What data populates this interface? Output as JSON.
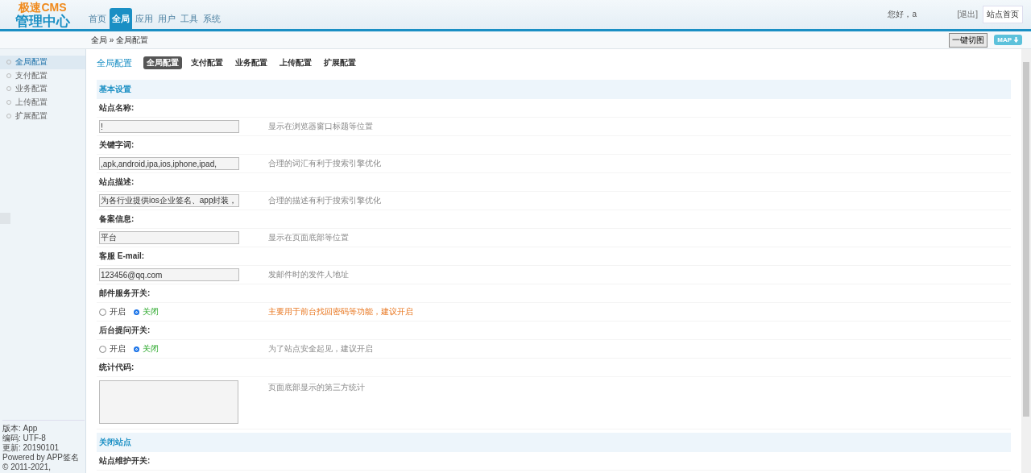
{
  "logo": {
    "line1": "极速CMS",
    "line2": "管理中心"
  },
  "nav": [
    {
      "label": "首页",
      "selected": false
    },
    {
      "label": "全局",
      "selected": true
    },
    {
      "label": "应用",
      "selected": false
    },
    {
      "label": "用户",
      "selected": false
    },
    {
      "label": "工具",
      "selected": false
    },
    {
      "label": "系统",
      "selected": false
    }
  ],
  "user": {
    "greeting": "您好，a",
    "logout": "[退出]",
    "home": "站点首页"
  },
  "breadcrumb": "全局 » 全局配置",
  "actions": {
    "button": "一键切图",
    "map": "MAP"
  },
  "sidebar": {
    "items": [
      {
        "label": "全局配置",
        "selected": true
      },
      {
        "label": "支付配置",
        "selected": false
      },
      {
        "label": "业务配置",
        "selected": false
      },
      {
        "label": "上传配置",
        "selected": false
      },
      {
        "label": "扩展配置",
        "selected": false
      }
    ],
    "footer": [
      "版本: App",
      "编码: UTF-8",
      "更新: 20190101",
      "Powered by APP签名",
      "© 2011-2021,"
    ]
  },
  "page_title": "全局配置",
  "tabs": [
    {
      "label": "全局配置",
      "selected": true
    },
    {
      "label": "支付配置",
      "selected": false
    },
    {
      "label": "业务配置",
      "selected": false
    },
    {
      "label": "上传配置",
      "selected": false
    },
    {
      "label": "扩展配置",
      "selected": false
    }
  ],
  "sections": [
    {
      "title": "基本设置",
      "fields": [
        {
          "kind": "text",
          "label": "站点名称:",
          "value": "!",
          "hint": "显示在浏览器窗口标题等位置",
          "warning": false
        },
        {
          "kind": "text",
          "label": "关键字词:",
          "value": ",apk,android,ipa,ios,iphone,ipad,",
          "hint": "合理的词汇有利于搜索引擎优化",
          "warning": false
        },
        {
          "kind": "text",
          "label": "站点描述:",
          "value": "为各行业提供ios企业签名、app封装，",
          "hint": "合理的描述有利于搜索引擎优化",
          "warning": false
        },
        {
          "kind": "text",
          "label": "备案信息:",
          "value": "平台",
          "hint": "显示在页面底部等位置",
          "warning": false
        },
        {
          "kind": "text",
          "label": "客服 E-mail:",
          "value": "123456@qq.com",
          "hint": "发邮件时的发件人地址",
          "warning": false
        },
        {
          "kind": "radio",
          "label": "邮件服务开关:",
          "options": [
            {
              "label": "开启",
              "selected": false
            },
            {
              "label": "关闭",
              "selected": true
            }
          ],
          "hint": "主要用于前台找回密码等功能，建议开启",
          "warning": true
        },
        {
          "kind": "radio",
          "label": "后台提问开关:",
          "options": [
            {
              "label": "开启",
              "selected": false
            },
            {
              "label": "关闭",
              "selected": true
            }
          ],
          "hint": "为了站点安全起见，建议开启",
          "warning": false
        },
        {
          "kind": "textarea",
          "label": "统计代码:",
          "hint": "页面底部显示的第三方统计",
          "warning": false
        }
      ]
    },
    {
      "title": "关闭站点",
      "fields": [
        {
          "kind": "label",
          "label": "站点维护开关:"
        }
      ]
    }
  ]
}
